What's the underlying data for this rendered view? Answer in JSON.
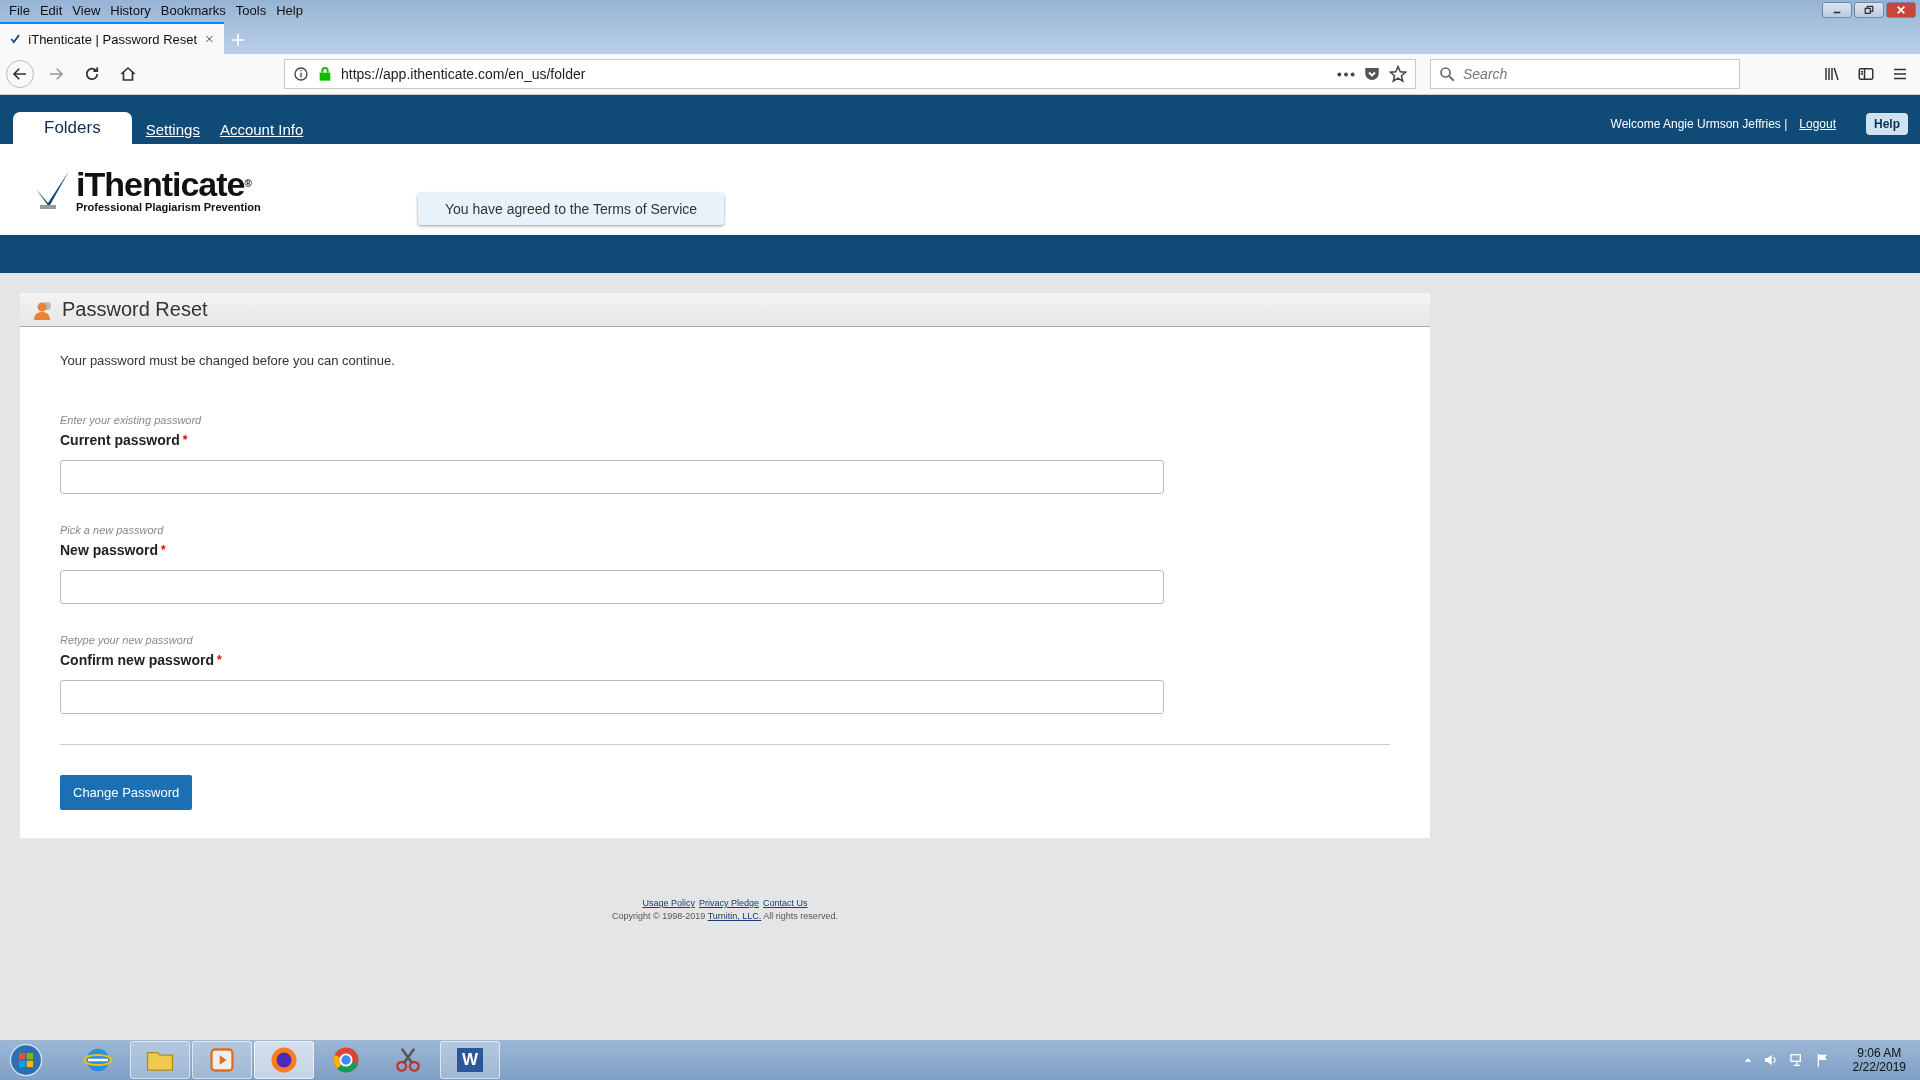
{
  "browser": {
    "menu": [
      "File",
      "Edit",
      "View",
      "History",
      "Bookmarks",
      "Tools",
      "Help"
    ],
    "tabs": [
      {
        "title": "iThenticate | Password Reset",
        "selected": true
      }
    ],
    "url": "https://app.ithenticate.com/en_us/folder",
    "search": {
      "placeholder": "Search"
    }
  },
  "app_nav": {
    "tabs": [
      {
        "label": "Folders",
        "selected": true
      },
      {
        "label": "Settings",
        "selected": false
      },
      {
        "label": "Account Info",
        "selected": false
      }
    ],
    "welcome": "Welcome Angie Urmson Jeffries |",
    "logout": "Logout",
    "help": "Help"
  },
  "logo": {
    "name": "iThenticate",
    "registered": "®",
    "tagline": "Professional Plagiarism Prevention"
  },
  "notice": "You have agreed to the Terms of Service",
  "panel": {
    "title": "Password Reset",
    "intro": "Your password must be changed before you can continue.",
    "required_mark": "*",
    "fields": [
      {
        "hint": "Enter your existing password",
        "label": "Current password",
        "required": true
      },
      {
        "hint": "Pick a new password",
        "label": "New password",
        "required": true
      },
      {
        "hint": "Retype your new password",
        "label": "Confirm new password",
        "required": true
      }
    ],
    "submit": "Change Password"
  },
  "footer": {
    "links": [
      "Usage Policy",
      "Privacy Pledge",
      "Contact Us"
    ],
    "copyright": "Copyright © 1998-2019",
    "company": "Turnitin, LLC.",
    "rights": "All rights reserved."
  },
  "taskbar": {
    "apps": [
      {
        "kind": "ie",
        "running": false,
        "selected": false
      },
      {
        "kind": "folder",
        "running": true,
        "selected": false
      },
      {
        "kind": "media",
        "running": true,
        "selected": false
      },
      {
        "kind": "firefox",
        "running": true,
        "selected": true
      },
      {
        "kind": "chrome",
        "running": false,
        "selected": false
      },
      {
        "kind": "snip",
        "running": false,
        "selected": false
      },
      {
        "kind": "word",
        "running": true,
        "selected": false
      }
    ],
    "word_letter": "W",
    "time": "9:06 AM",
    "date": "2/22/2019"
  }
}
